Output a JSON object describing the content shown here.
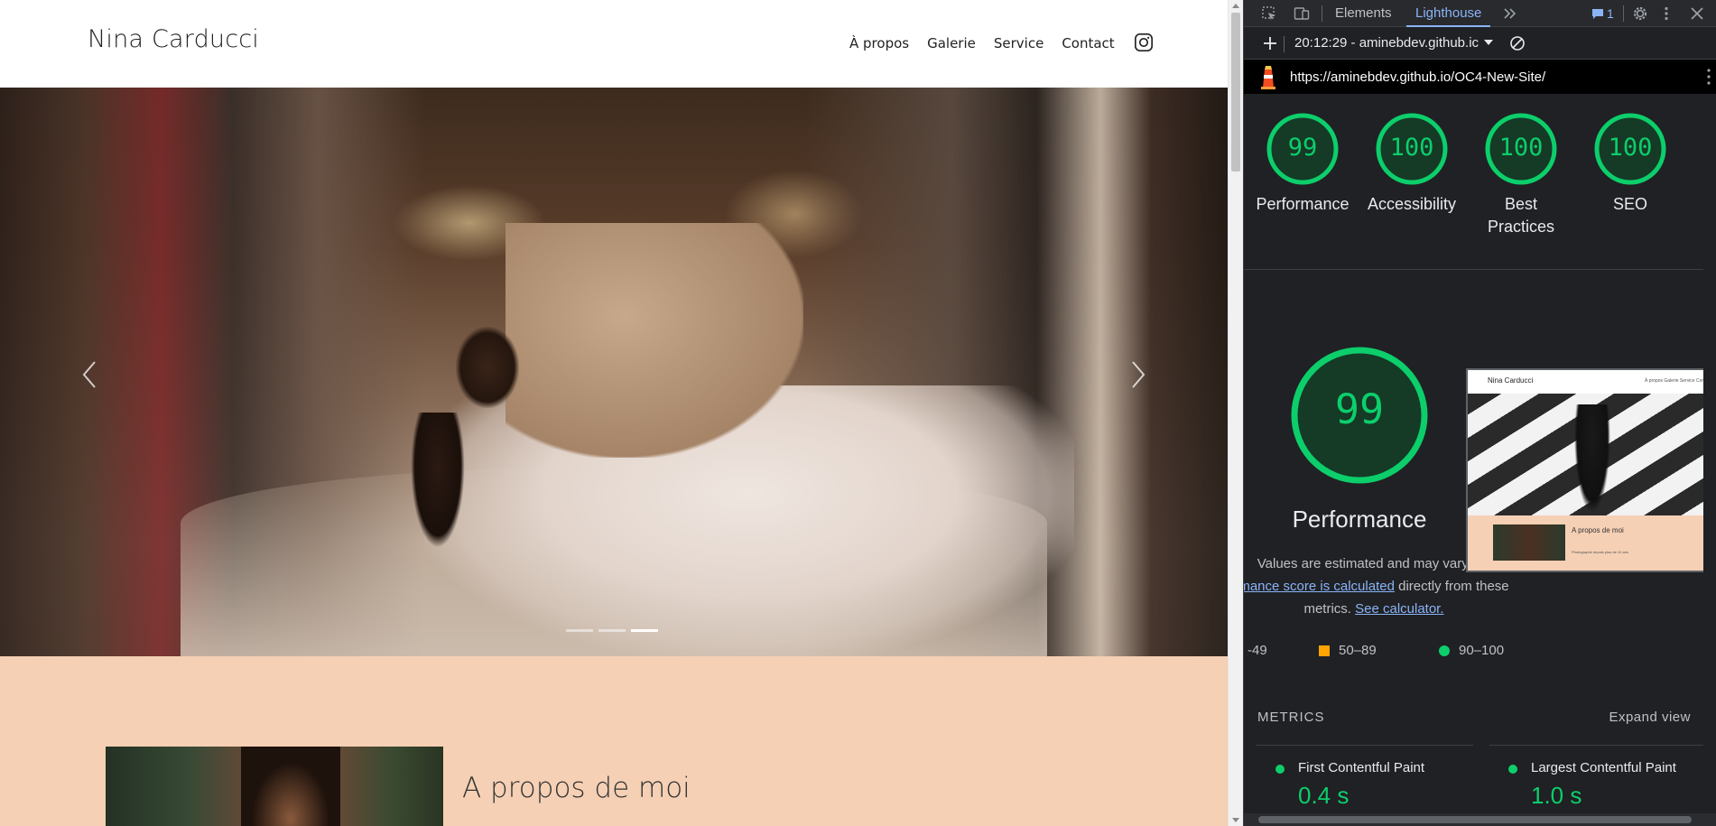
{
  "site": {
    "brand": "Nina Carducci",
    "nav": [
      "À propos",
      "Galerie",
      "Service",
      "Contact"
    ],
    "about_title": "A propos de moi"
  },
  "devtools": {
    "tabs": [
      "Elements",
      "Lighthouse"
    ],
    "issues_count": "1",
    "report_select": "20:12:29 - aminebdev.github.ic",
    "url": "https://aminebdev.github.io/OC4-New-Site/",
    "scores": [
      {
        "value": "99",
        "label": "Performance"
      },
      {
        "value": "100",
        "label": "Accessibility"
      },
      {
        "value": "100",
        "label": "Best Practices"
      },
      {
        "value": "100",
        "label": "SEO"
      }
    ],
    "perf_score": "99",
    "perf_title": "Performance",
    "perf_note_1": "Values are estimated and may vary. Th",
    "perf_note_link": "mance score is calculated",
    "perf_note_2": " directly from these",
    "perf_note_3": "metrics. ",
    "perf_note_link2": "See calculator.",
    "legend": [
      "-49",
      "50–89",
      "90–100"
    ],
    "metrics_title": "METRICS",
    "expand_view": "Expand view",
    "metrics": [
      {
        "label": "First Contentful Paint",
        "value": "0.4 s"
      },
      {
        "label": "Largest Contentful Paint",
        "value": "1.0 s"
      }
    ],
    "thumb": {
      "brand": "Nina Carducci",
      "nav": "À propos  Galerie  Service  Contact",
      "title": "A propos de moi",
      "sub": "Photographe depuis plus de 10 ans"
    }
  },
  "colors": {
    "accent_green": "#0cce6b",
    "accent_orange": "#ffa400",
    "link_blue": "#8ab4f8",
    "about_bg": "#f5d0b5",
    "devtools_bg": "#202124"
  }
}
